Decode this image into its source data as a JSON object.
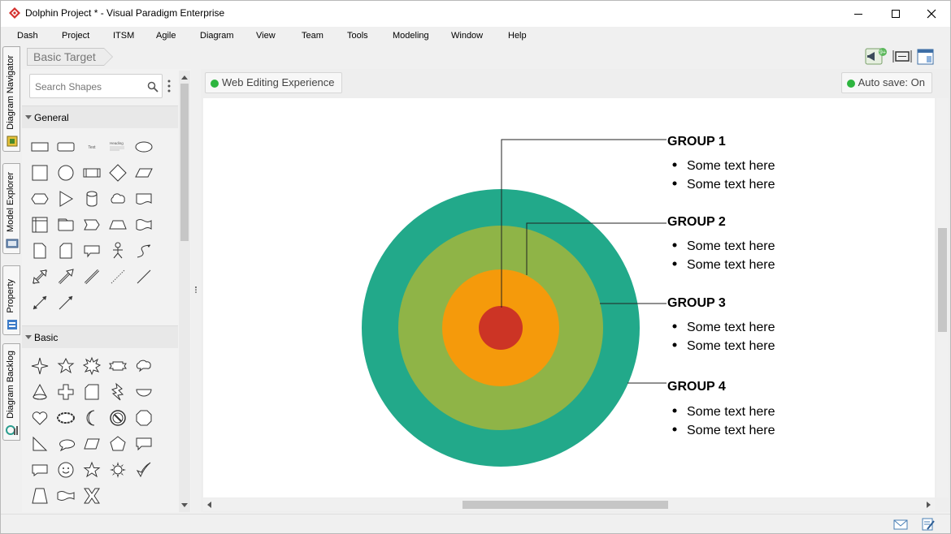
{
  "window": {
    "title": "Dolphin Project * - Visual Paradigm Enterprise",
    "minimize_label": "minimize",
    "maximize_label": "maximize",
    "close_label": "close"
  },
  "menu": [
    "Dash",
    "Project",
    "ITSM",
    "Agile",
    "Diagram",
    "View",
    "Team",
    "Tools",
    "Modeling",
    "Window",
    "Help"
  ],
  "side_tabs": [
    {
      "label": "Diagram Navigator",
      "icon": "diagram-navigator-icon"
    },
    {
      "label": "Model Explorer",
      "icon": "model-explorer-icon"
    },
    {
      "label": "Property",
      "icon": "property-icon"
    },
    {
      "label": "Diagram Backlog",
      "icon": "diagram-backlog-icon"
    }
  ],
  "breadcrumb": "Basic Target",
  "toolbar": {
    "notification_badge": "9+"
  },
  "shape_panel": {
    "search_placeholder": "Search Shapes",
    "sections": [
      "General",
      "Basic"
    ],
    "general_text_shape": "Text",
    "general_heading_shape": "Heading"
  },
  "canvas": {
    "web_editing": "Web Editing Experience",
    "autosave": "Auto save: On"
  },
  "diagram": {
    "colors": {
      "ring4": "#22a98a",
      "ring3": "#8fb447",
      "ring2": "#f59a0b",
      "ring1": "#cc3425"
    },
    "groups": [
      {
        "title": "GROUP 1",
        "items": [
          "Some text here",
          "Some text here"
        ]
      },
      {
        "title": "GROUP 2",
        "items": [
          "Some text here",
          "Some text here"
        ]
      },
      {
        "title": "GROUP 3",
        "items": [
          "Some text here",
          "Some text here"
        ]
      },
      {
        "title": "GROUP 4",
        "items": [
          "Some text here",
          "Some text here"
        ]
      }
    ]
  }
}
